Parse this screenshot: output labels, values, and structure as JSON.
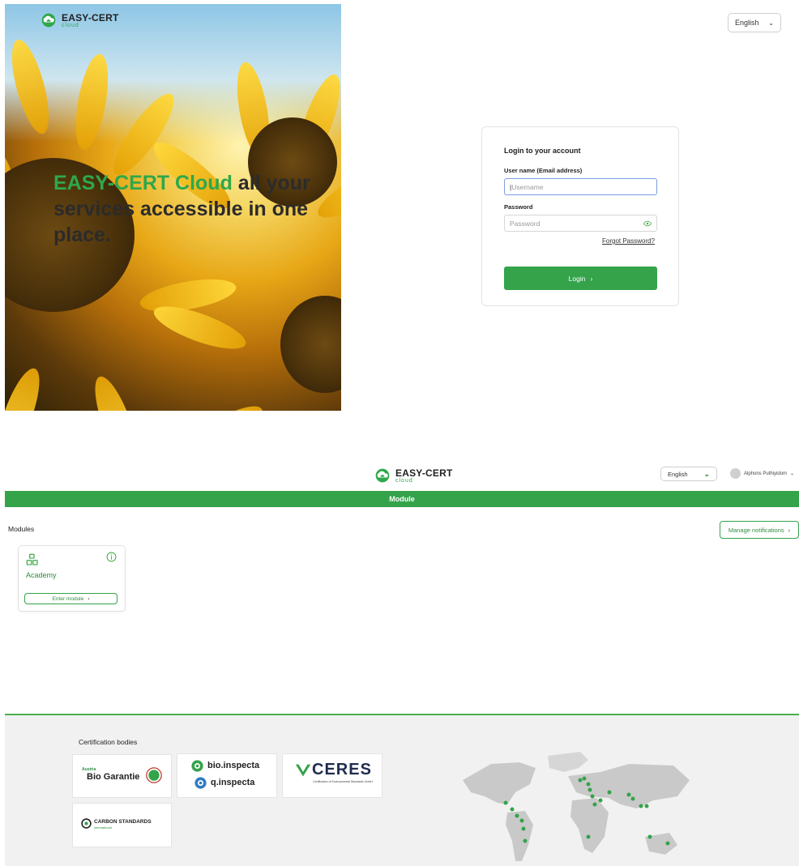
{
  "login_screen": {
    "brand": {
      "name": "EASY-CERT",
      "sub": "cloud"
    },
    "hero": {
      "accent": "EASY-CERT Cloud",
      "text": " all your services accessible in one place."
    },
    "language": {
      "selected": "English"
    },
    "card": {
      "title": "Login to your account",
      "username_label": "User name (Email address)",
      "username_placeholder": "Username",
      "password_label": "Password",
      "password_placeholder": "Password",
      "forgot": "Forgot Password?",
      "login_button": "Login"
    }
  },
  "dashboard": {
    "brand": {
      "name": "EASY-CERT",
      "sub": "cloud"
    },
    "language": {
      "selected": "English"
    },
    "user": {
      "name": "Alphons Puthiyidom"
    },
    "bar_title": "Module",
    "section_title": "Modules",
    "manage_notifications": "Manage notifications",
    "modules": [
      {
        "name": "Academy",
        "enter_label": "Enter module"
      }
    ],
    "footer": {
      "title": "Certification bodies",
      "logos": [
        {
          "small": "Austria",
          "big": "Bio Garantie"
        },
        {
          "line1": "bio.inspecta",
          "line2": "q.inspecta"
        },
        {
          "big": "CERES",
          "small": "Certification of Environmental Standards GmbH"
        },
        {
          "big": "CARBON STANDARDS",
          "small": "international"
        }
      ]
    }
  },
  "colors": {
    "accent": "#34a34a",
    "accent_text": "#2ea84a",
    "focus": "#7b9ee0"
  },
  "icons": [
    "easy-cert-cloud-logo-icon",
    "chevron-down-icon",
    "eye-icon",
    "chevron-right-icon",
    "modules-grid-icon",
    "info-icon",
    "avatar"
  ]
}
